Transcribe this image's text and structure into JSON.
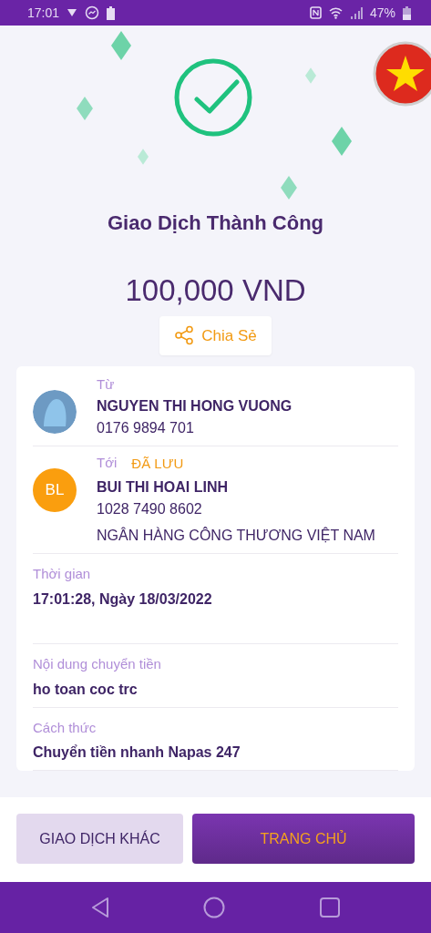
{
  "status_bar": {
    "time": "17:01",
    "battery": "47%"
  },
  "result": {
    "title": "Giao Dịch Thành Công",
    "amount": "100,000 VND",
    "share_button": "Chia Sẻ"
  },
  "sender": {
    "label": "Từ",
    "name": "NGUYEN THI HONG VUONG",
    "account": "0176 9894 701"
  },
  "recipient": {
    "label": "Tới",
    "tag": "ĐÃ LƯU",
    "initials": "BL",
    "name": "BUI THI HOAI LINH",
    "account": "1028 7490 8602",
    "bank": "NGÂN HÀNG CÔNG THƯƠNG VIỆT NAM"
  },
  "details": [
    {
      "label": "Thời gian",
      "value": "17:01:28, Ngày 18/03/2022"
    },
    {
      "label": "Nội dung chuyển tiền",
      "value": "ho toan coc trc"
    },
    {
      "label": "Cách thức",
      "value": "Chuyển tiền nhanh Napas 247"
    }
  ],
  "buttons": [
    {
      "label": "GIAO DỊCH KHÁC",
      "kind": "secondary"
    },
    {
      "label": "TRANG CHỦ",
      "kind": "primary"
    }
  ]
}
